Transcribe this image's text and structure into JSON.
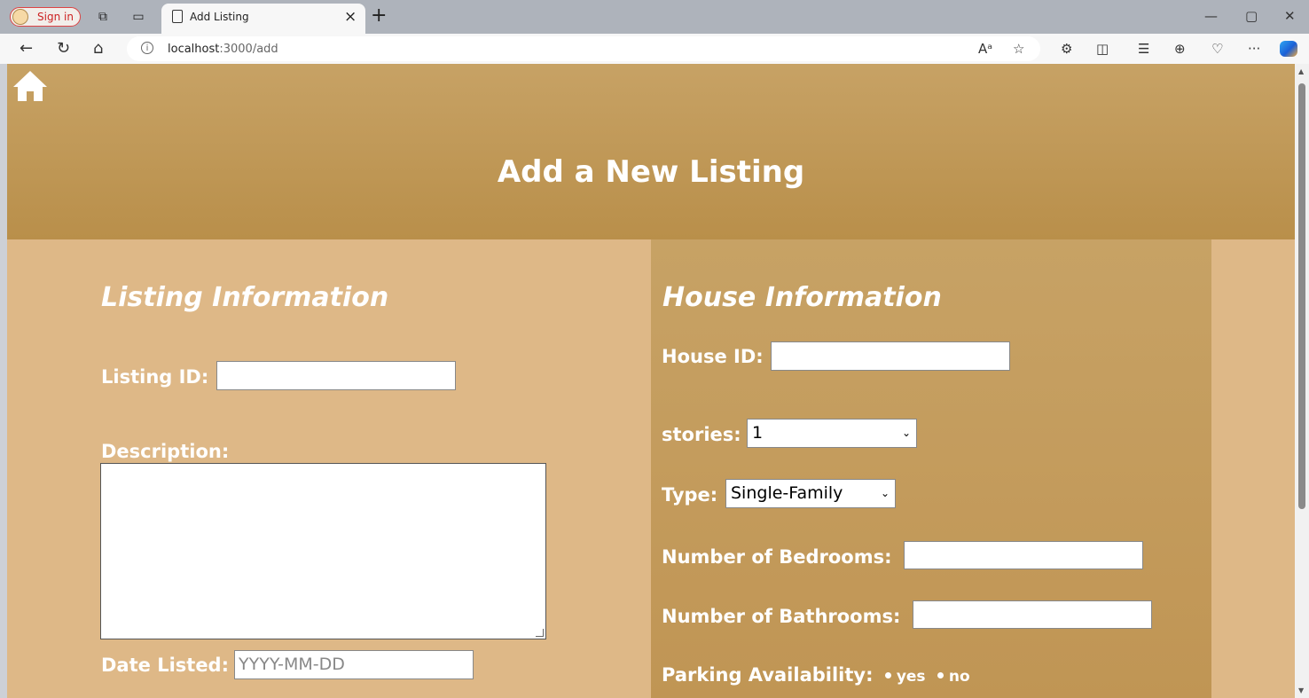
{
  "browser": {
    "signin_label": "Sign in",
    "tab_title": "Add Listing",
    "tab_close": "×",
    "new_tab": "+",
    "url_host": "localhost",
    "url_path": ":3000/add",
    "window": {
      "minimize": "—",
      "restore": "▢",
      "close": "✕"
    },
    "toolbar_icons": [
      "read-aloud-icon",
      "favorite-star-icon",
      "extensions-icon",
      "split-screen-icon",
      "favorites-icon",
      "collections-icon",
      "browser-essentials-icon",
      "more-icon",
      "copilot-icon"
    ]
  },
  "header": {
    "title": "Add a New Listing",
    "home_icon": "home-icon"
  },
  "listing": {
    "section_title": "Listing Information",
    "listing_id_label": "Listing ID:",
    "listing_id_value": "",
    "description_label": "Description:",
    "description_value": "",
    "date_label": "Date Listed:",
    "date_placeholder": "YYYY-MM-DD"
  },
  "house": {
    "section_title": "House Information",
    "house_id_label": "House ID:",
    "house_id_value": "",
    "stories_label": "stories:",
    "stories_selected": "1",
    "type_label": "Type:",
    "type_selected": "Single-Family",
    "bedrooms_label": "Number of Bedrooms:",
    "bathrooms_label": "Number of Bathrooms:",
    "parking_label": "Parking Availability:",
    "parking_yes": "yes",
    "parking_no": "no"
  },
  "colors": {
    "page_bg": "#deb887",
    "header_bg": "#c29a5a",
    "panel_bg": "#c49c5d",
    "text": "#ffffff"
  }
}
